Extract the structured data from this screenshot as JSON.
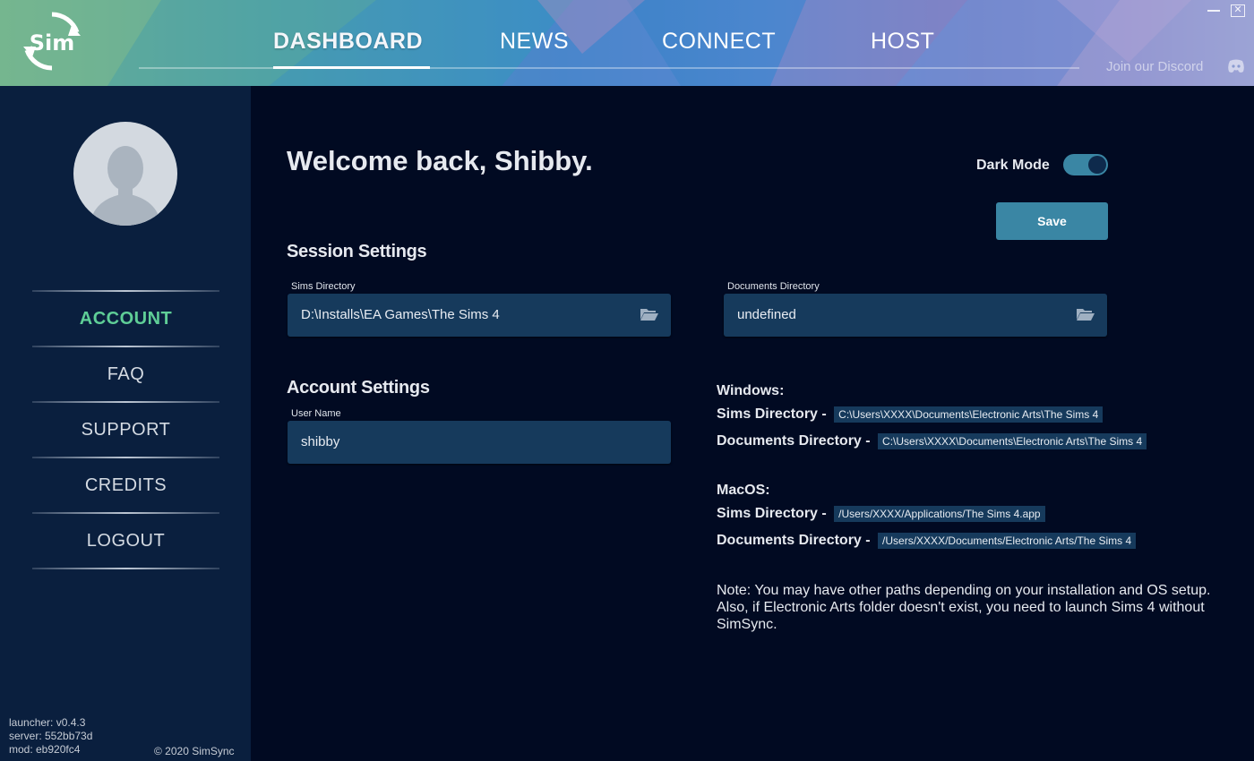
{
  "app": {
    "logo_text": "Sim"
  },
  "nav": {
    "items": [
      {
        "label": "DASHBOARD",
        "active": true
      },
      {
        "label": "NEWS",
        "active": false
      },
      {
        "label": "CONNECT",
        "active": false
      },
      {
        "label": "HOST",
        "active": false
      }
    ],
    "discord_label": "Join our Discord"
  },
  "sidebar": {
    "items": [
      {
        "label": "ACCOUNT",
        "active": true
      },
      {
        "label": "FAQ",
        "active": false
      },
      {
        "label": "SUPPORT",
        "active": false
      },
      {
        "label": "CREDITS",
        "active": false
      },
      {
        "label": "LOGOUT",
        "active": false
      }
    ],
    "versions": {
      "launcher": "launcher: v0.4.3",
      "server": "server: 552bb73d",
      "mod": "mod: eb920fc4"
    },
    "copyright": "© 2020 SimSync"
  },
  "main": {
    "welcome": "Welcome back, Shibby.",
    "dark_mode_label": "Dark Mode",
    "dark_mode_on": true,
    "save_label": "Save",
    "session": {
      "title": "Session Settings",
      "sims_dir_label": "Sims Directory",
      "sims_dir_value": "D:\\Installs\\EA Games\\The Sims 4",
      "docs_dir_label": "Documents Directory",
      "docs_dir_value": "undefined"
    },
    "account": {
      "title": "Account Settings",
      "username_label": "User Name",
      "username_value": "shibby"
    },
    "help": {
      "windows": {
        "title": "Windows:",
        "sims_key": "Sims Directory -",
        "sims_val": "C:\\Users\\XXXX\\Documents\\Electronic Arts\\The Sims 4",
        "docs_key": "Documents Directory -",
        "docs_val": "C:\\Users\\XXXX\\Documents\\Electronic Arts\\The Sims 4"
      },
      "macos": {
        "title": "MacOS:",
        "sims_key": "Sims Directory -",
        "sims_val": "/Users/XXXX/Applications/The Sims 4.app",
        "docs_key": "Documents Directory -",
        "docs_val": "/Users/XXXX/Documents/Electronic Arts/The Sims 4"
      },
      "note": "Note: You may have other paths depending on your installation and OS setup. Also, if Electronic Arts folder doesn't exist, you need to launch Sims 4 without SimSync."
    }
  },
  "colors": {
    "accent": "#3a86a4",
    "active_green": "#5fce97",
    "field_bg": "#163a5c",
    "sidebar_bg": "#0a1f3e",
    "main_bg": "#010a22"
  },
  "icons": {
    "logo": "sim-sync-logo",
    "folder": "folder-open-icon",
    "discord": "discord-icon",
    "avatar": "user-avatar-placeholder"
  }
}
